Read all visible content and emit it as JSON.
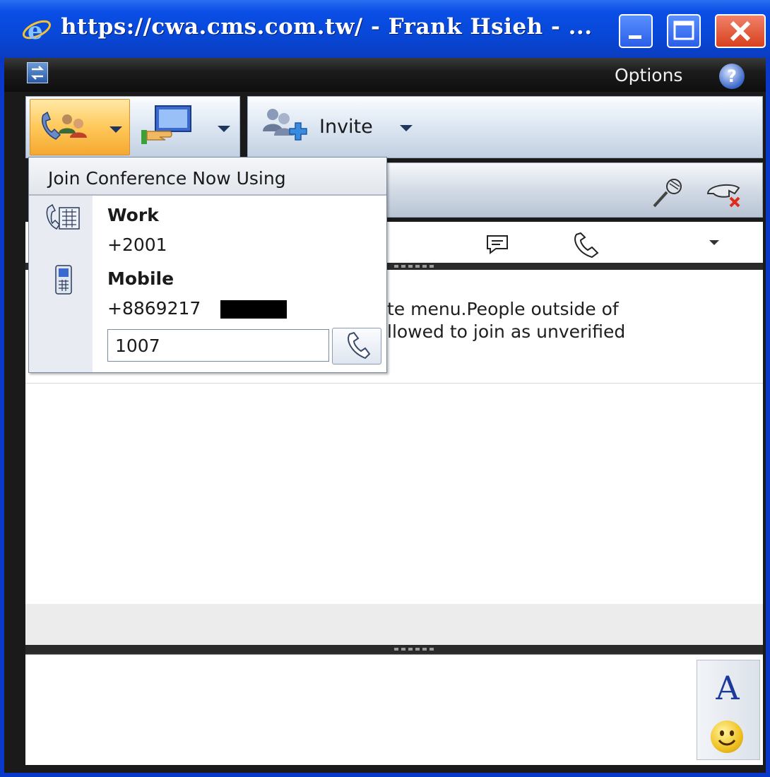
{
  "window": {
    "title": "https://cwa.cms.com.tw/ - Frank Hsieh - ...",
    "buttons": [
      "minimize",
      "maximize",
      "close"
    ]
  },
  "header": {
    "options_label": "Options",
    "help_label": "?"
  },
  "toolbar": {
    "invite_label": "Invite"
  },
  "join_menu": {
    "heading": "Join Conference Now Using",
    "work": {
      "label": "Work",
      "number": "+2001"
    },
    "mobile": {
      "label": "Mobile",
      "number": "+8869217"
    },
    "custom_number_value": "1007"
  },
  "conversation": {
    "line1": "te menu.People outside of",
    "line2": "llowed to join as unverified"
  },
  "input_tools": {
    "font_label": "A"
  },
  "colors": {
    "title_bar": "#0a4ee6",
    "active_button": "#ffc85a",
    "close_button": "#d8401e"
  },
  "icons": [
    "ie-icon",
    "app-icon",
    "help-icon",
    "conference-call-icon",
    "share-desktop-icon",
    "invite-people-icon",
    "microphone-icon",
    "hangup-icon",
    "chat-icon",
    "phone-icon",
    "work-phone-icon",
    "mobile-phone-icon",
    "dial-phone-icon",
    "font-icon",
    "emoticon-icon"
  ]
}
